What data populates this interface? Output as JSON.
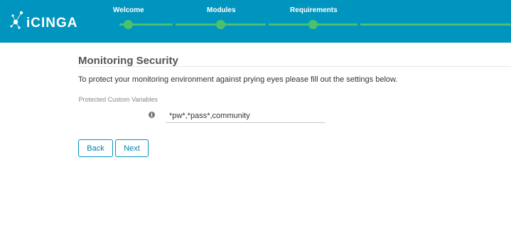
{
  "logo": {
    "text": "iCINGA"
  },
  "wizard": {
    "steps": [
      {
        "label": "Welcome"
      },
      {
        "label": "Modules"
      },
      {
        "label": "Requirements"
      }
    ]
  },
  "page": {
    "title": "Monitoring Security",
    "description": "To protect your monitoring environment against prying eyes please fill out the settings below."
  },
  "form": {
    "protected_vars_label": "Protected Custom Variables",
    "protected_vars_value": "*pw*,*pass*,community",
    "info_icon": "i"
  },
  "buttons": {
    "back": "Back",
    "next": "Next"
  },
  "colors": {
    "header": "#0095bf",
    "progress": "#4bc16e",
    "button_border": "#0095bf"
  }
}
